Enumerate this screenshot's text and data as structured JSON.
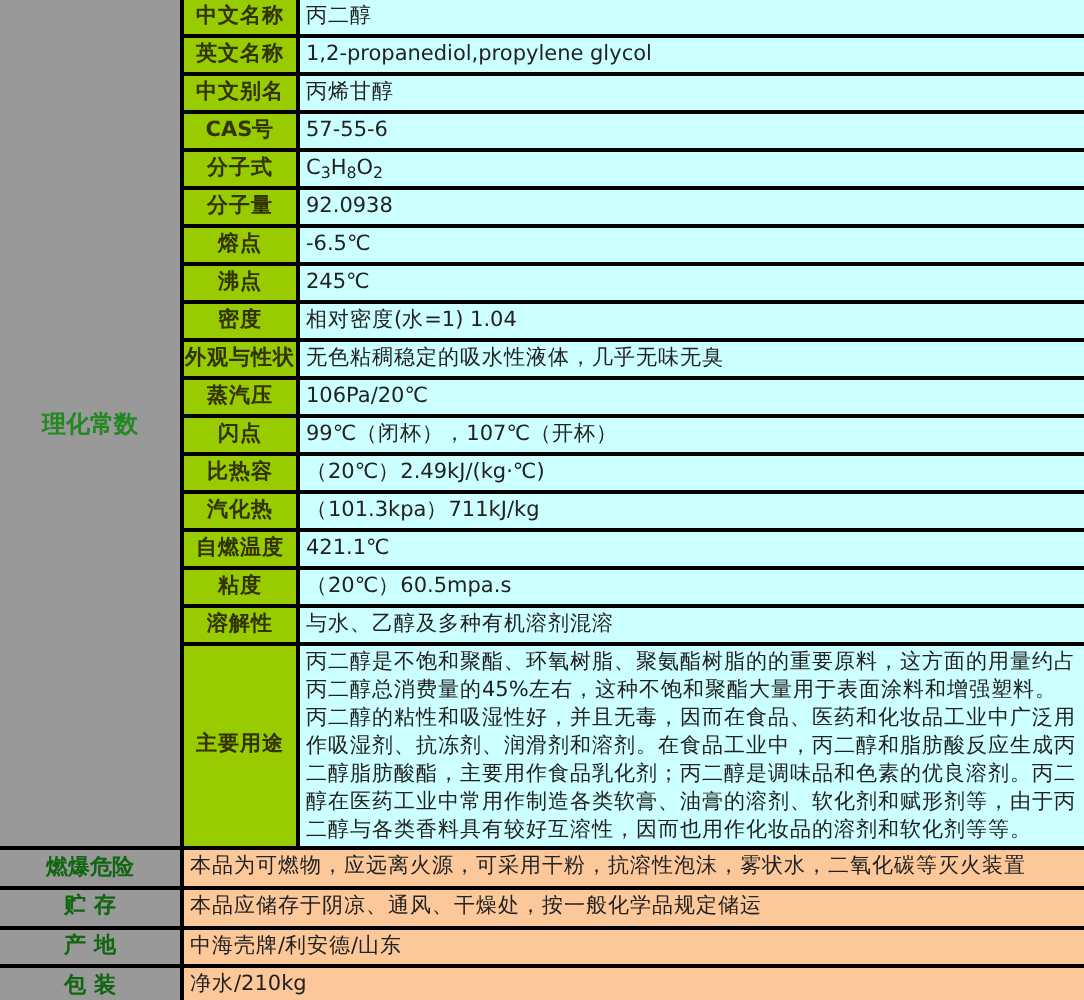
{
  "section": {
    "label": "理化常数",
    "properties": [
      {
        "label": "中文名称",
        "value": "丙二醇"
      },
      {
        "label": "英文名称",
        "value": "1,2-propanediol,propylene glycol"
      },
      {
        "label": "中文别名",
        "value": "丙烯甘醇"
      },
      {
        "label": "CAS号",
        "value": "57-55-6"
      },
      {
        "label": "分子式",
        "value": "C$_{3}$H$_{8}$O$_{2}$"
      },
      {
        "label": "分子量",
        "value": "92.0938"
      },
      {
        "label": "熔点",
        "value": "-6.5℃"
      },
      {
        "label": "沸点",
        "value": "245℃"
      },
      {
        "label": "密度",
        "value": "相对密度(水=1) 1.04"
      },
      {
        "label": "外观与性状",
        "value": "无色粘稠稳定的吸水性液体，几乎无味无臭"
      },
      {
        "label": "蒸汽压",
        "value": "106Pa/20℃"
      },
      {
        "label": "闪点",
        "value": "99℃（闭杯），107℃（开杯）"
      },
      {
        "label": "比热容",
        "value": "（20℃）2.49kJ/(kg·℃)"
      },
      {
        "label": "汽化热",
        "value": "（101.3kpa）711kJ/kg"
      },
      {
        "label": "自燃温度",
        "value": "421.1℃"
      },
      {
        "label": "粘度",
        "value": "（20℃）60.5mpa.s"
      },
      {
        "label": "溶解性",
        "value": "与水、乙醇及多种有机溶剂混溶"
      },
      {
        "label": "主要用途",
        "value": "丙二醇是不饱和聚酯、环氧树脂、聚氨酯树脂的的重要原料，这方面的用量约占丙二醇总消费量的45%左右，这种不饱和聚酯大量用于表面涂料和增强塑料。丙二醇的粘性和吸湿性好，并且无毒，因而在食品、医药和化妆品工业中广泛用作吸湿剂、抗冻剂、润滑剂和溶剂。在食品工业中，丙二醇和脂肪酸反应生成丙二醇脂肪酸酯，主要用作食品乳化剂；丙二醇是调味品和色素的优良溶剂。丙二醇在医药工业中常用作制造各类软膏、油膏的溶剂、软化剂和赋形剂等，由于丙二醇与各类香料具有较好互溶性，因而也用作化妆品的溶剂和软化剂等等。"
      }
    ]
  },
  "other_rows": [
    {
      "label": "燃爆危险",
      "value": "本品为可燃物，应远离火源，可采用干粉，抗溶性泡沫，雾状水，二氧化碳等灭火装置"
    },
    {
      "label": "贮 存",
      "value": "本品应储存于阴凉、通风、干燥处，按一般化学品规定储运"
    },
    {
      "label": "产 地",
      "value": "中海壳牌/利安德/山东"
    },
    {
      "label": "包 装",
      "value": "净水/210kg"
    }
  ]
}
